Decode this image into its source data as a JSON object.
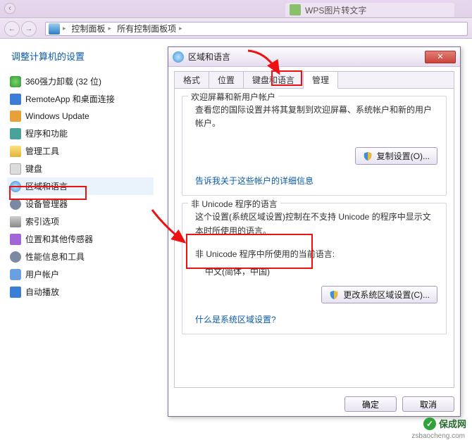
{
  "top_tab": {
    "icon": "image-icon",
    "label": "WPS图片转文字"
  },
  "addr": {
    "icon": "control-panel-icon",
    "seg1": "控制面板",
    "seg2": "所有控制面板项"
  },
  "cp": {
    "title": "调整计算机的设置",
    "items": [
      {
        "label": "360强力卸载 (32 位)",
        "name": "item-360-uninstall",
        "icon": "green"
      },
      {
        "label": "RemoteApp 和桌面连接",
        "name": "item-remoteapp",
        "icon": "blue"
      },
      {
        "label": "Windows Update",
        "name": "item-windows-update",
        "icon": "orange"
      },
      {
        "label": "程序和功能",
        "name": "item-programs",
        "icon": "teal"
      },
      {
        "label": "管理工具",
        "name": "item-admin-tools",
        "icon": "folder"
      },
      {
        "label": "键盘",
        "name": "item-keyboard",
        "icon": "kbd"
      },
      {
        "label": "区域和语言",
        "name": "item-region-language",
        "icon": "globe",
        "active": true
      },
      {
        "label": "设备管理器",
        "name": "item-device-manager",
        "icon": "gear"
      },
      {
        "label": "索引选项",
        "name": "item-index-options",
        "icon": "disk"
      },
      {
        "label": "位置和其他传感器",
        "name": "item-sensors",
        "icon": "sensor"
      },
      {
        "label": "性能信息和工具",
        "name": "item-performance",
        "icon": "gear"
      },
      {
        "label": "用户帐户",
        "name": "item-user-accounts",
        "icon": "user"
      },
      {
        "label": "自动播放",
        "name": "item-autoplay",
        "icon": "play"
      }
    ]
  },
  "dialog": {
    "title": "区域和语言",
    "close_icon": "close-icon",
    "tabs": [
      {
        "label": "格式",
        "name": "tab-format"
      },
      {
        "label": "位置",
        "name": "tab-location"
      },
      {
        "label": "键盘和语言",
        "name": "tab-keyboard-language"
      },
      {
        "label": "管理",
        "name": "tab-admin",
        "active": true
      }
    ],
    "group1": {
      "title": "欢迎屏幕和新用户帐户",
      "desc": "查看您的国际设置并将其复制到欢迎屏幕、系统帐户和新的用户帐户。",
      "button": "复制设置(O)...",
      "link": "告诉我关于这些帐户的详细信息"
    },
    "group2": {
      "title": "非 Unicode 程序的语言",
      "desc": "这个设置(系统区域设置)控制在不支持 Unicode 的程序中显示文本时所使用的语言。",
      "current_label": "非 Unicode 程序中所使用的当前语言:",
      "current_value": "中文(简体，中国)",
      "button": "更改系统区域设置(C)...",
      "link": "什么是系统区域设置?"
    },
    "footer": {
      "ok": "确定",
      "cancel": "取消"
    }
  },
  "watermark": {
    "text": "保成网",
    "url": "zsbaocheng.com"
  }
}
